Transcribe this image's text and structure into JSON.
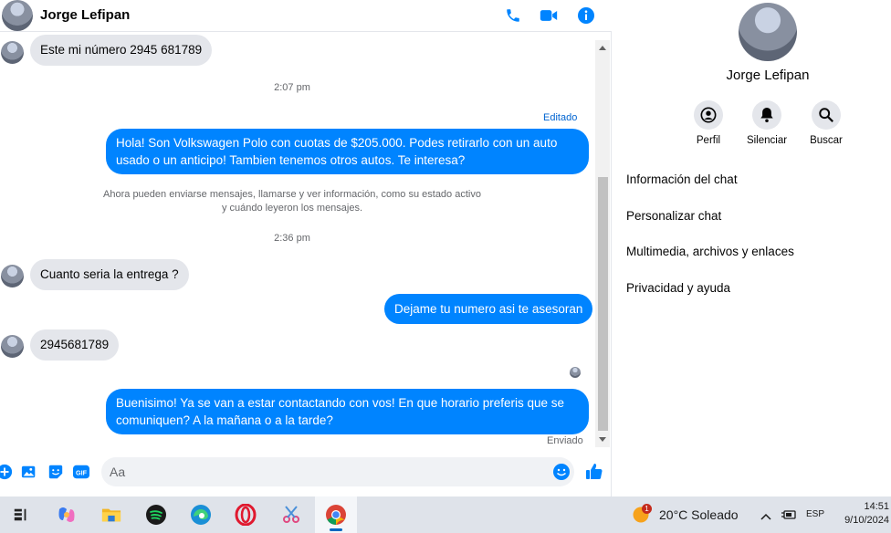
{
  "chat": {
    "contact_name": "Jorge Lefipan",
    "input_placeholder": "Aa",
    "messages": [
      {
        "type": "in",
        "text": "Este mi número 2945 681789"
      },
      {
        "type": "time",
        "text": "2:07 pm"
      },
      {
        "type": "meta",
        "text": "Editado"
      },
      {
        "type": "out",
        "text": "Hola! Son Volkswagen Polo con cuotas de $205.000. Podes retirarlo con un auto usado o un anticipo! Tambien tenemos otros autos. Te interesa?"
      },
      {
        "type": "note",
        "line1": "Ahora pueden enviarse mensajes, llamarse y ver información, como su estado activo",
        "line2": "y cuándo leyeron los mensajes."
      },
      {
        "type": "time",
        "text": "2:36 pm"
      },
      {
        "type": "in",
        "text": "Cuanto seria la entrega ?"
      },
      {
        "type": "out",
        "text": "Dejame tu numero asi te asesoran"
      },
      {
        "type": "in",
        "text": "2945681789"
      },
      {
        "type": "out",
        "text": "Buenisimo! Ya se van a estar contactando con vos! En que horario preferis que se comuniquen? A la mañana o a la tarde?"
      },
      {
        "type": "status",
        "text": "Enviado"
      }
    ]
  },
  "info_panel": {
    "name": "Jorge Lefipan",
    "actions": [
      {
        "label": "Perfil",
        "icon": "profile-icon"
      },
      {
        "label": "Silenciar",
        "icon": "bell-icon"
      },
      {
        "label": "Buscar",
        "icon": "search-icon"
      }
    ],
    "menu": [
      "Información del chat",
      "Personalizar chat",
      "Multimedia, archivos y enlaces",
      "Privacidad y ayuda"
    ]
  },
  "taskbar": {
    "weather": "20°C  Soleado",
    "weather_badge": "1",
    "language": "ESP",
    "time": "14:51",
    "date": "9/10/2024",
    "apps": [
      "task-view",
      "copilot",
      "file-explorer",
      "spotify",
      "edge",
      "opera",
      "snipping-tool",
      "chrome"
    ]
  },
  "colors": {
    "accent": "#0084ff",
    "incoming": "#e4e6eb",
    "taskbar": "#dfe3ea"
  }
}
